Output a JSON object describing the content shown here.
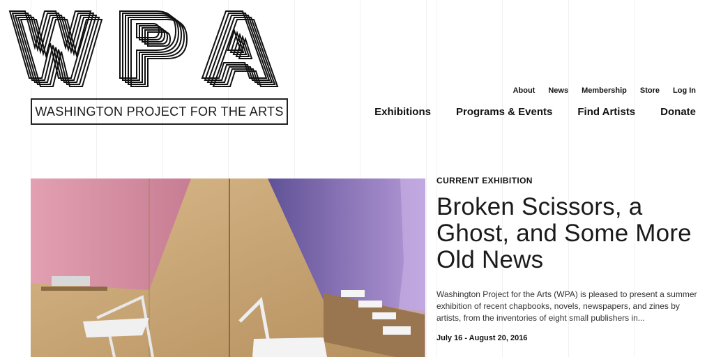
{
  "brand": {
    "logo_text": "WPA",
    "tagline": "WASHINGTON PROJECT FOR THE ARTS"
  },
  "utility_nav": [
    "About",
    "News",
    "Membership",
    "Store",
    "Log In"
  ],
  "main_nav": [
    "Exhibitions",
    "Programs & Events",
    "Find Artists",
    "Donate"
  ],
  "feature": {
    "eyebrow": "CURRENT EXHIBITION",
    "title": "Broken Scissors, a Ghost, and Some More Old News",
    "description": "Washington Project for the Arts (WPA) is pleased to present a summer exhibition of recent chapbooks, novels, newspapers, and zines by artists, from the inventories of eight small publishers in...",
    "dates": "July 16 - August 20, 2016"
  },
  "colors": {
    "pink_wall": "#d48aa0",
    "purple_wall": "#6b5fae",
    "plywood": "#caa678"
  }
}
